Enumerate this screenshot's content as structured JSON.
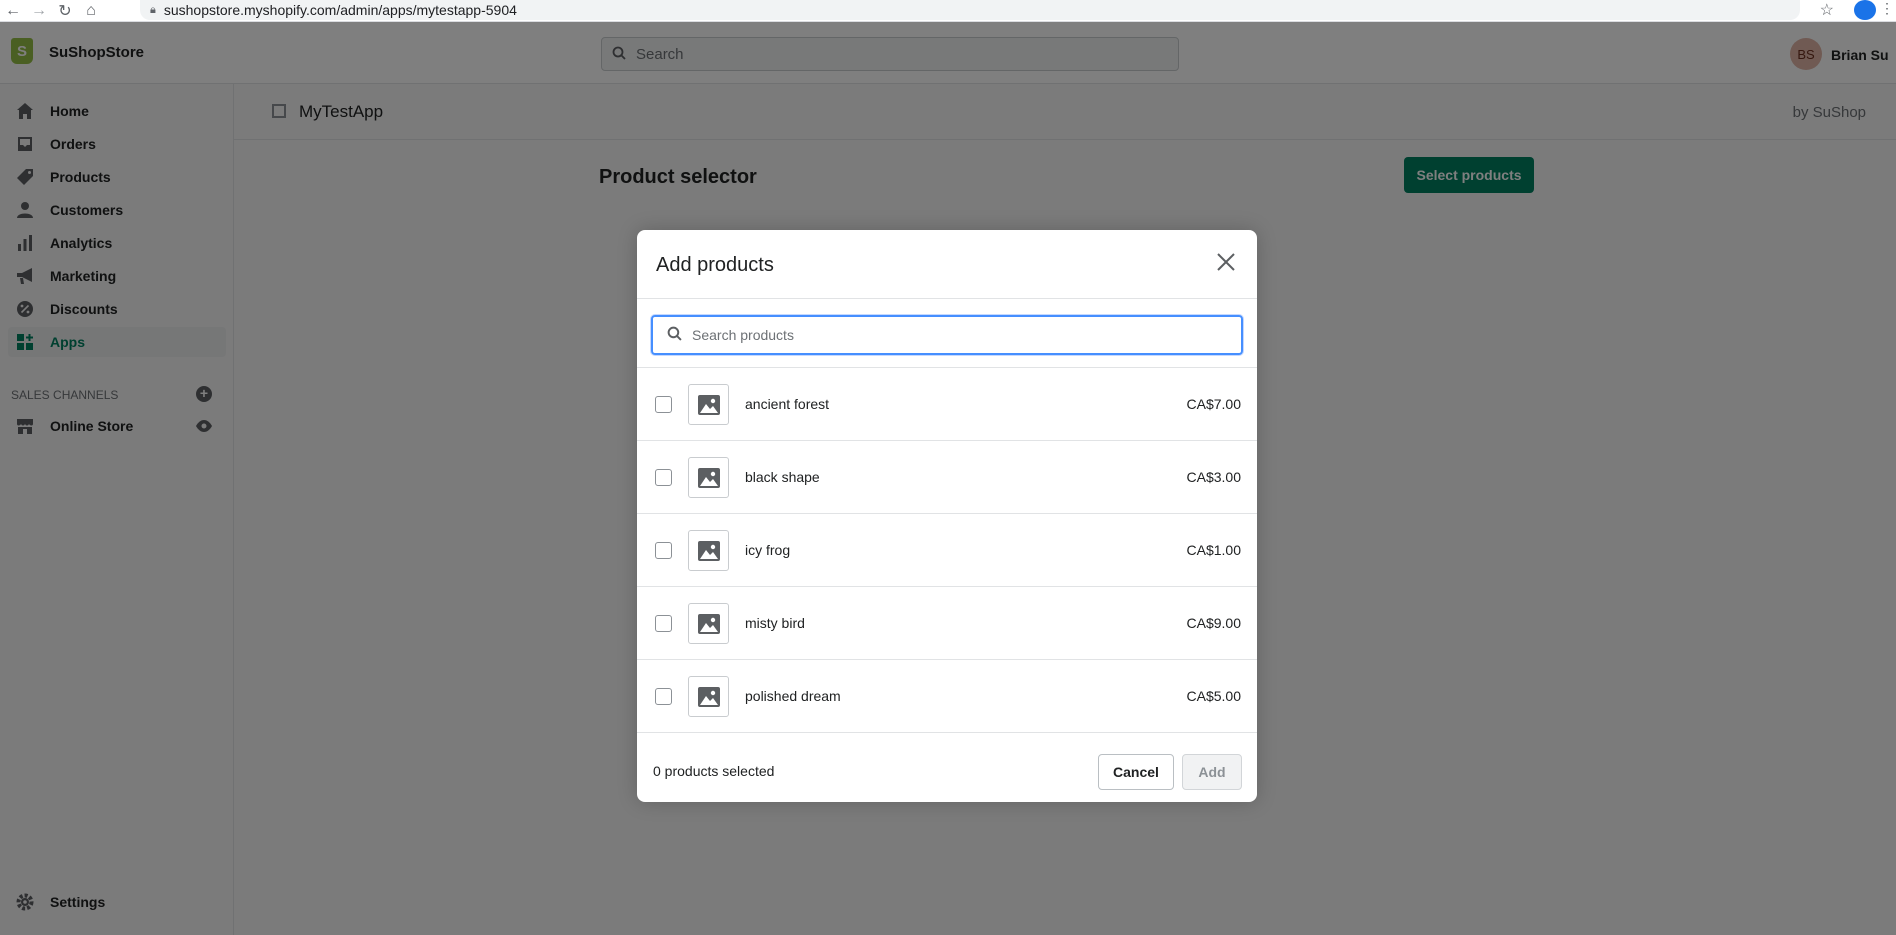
{
  "browser": {
    "url": "sushopstore.myshopify.com/admin/apps/mytestapp-5904",
    "back": "←",
    "forward": "→",
    "reload": "↻",
    "home": "⌂",
    "star": "☆",
    "more": "⋮"
  },
  "topbar": {
    "store_name": "SuShopStore",
    "search_placeholder": "Search",
    "avatar_initials": "BS",
    "user_name": "Brian Su"
  },
  "sidebar": {
    "items": [
      {
        "label": "Home",
        "icon": "home-icon"
      },
      {
        "label": "Orders",
        "icon": "orders-icon"
      },
      {
        "label": "Products",
        "icon": "tag-icon"
      },
      {
        "label": "Customers",
        "icon": "person-icon"
      },
      {
        "label": "Analytics",
        "icon": "bar-chart-icon"
      },
      {
        "label": "Marketing",
        "icon": "megaphone-icon"
      },
      {
        "label": "Discounts",
        "icon": "discount-icon"
      },
      {
        "label": "Apps",
        "icon": "apps-icon"
      }
    ],
    "sales_channels_title": "SALES CHANNELS",
    "online_store": "Online Store",
    "settings": "Settings"
  },
  "app": {
    "title": "MyTestApp",
    "by": "by SuShop",
    "page_title": "Product selector",
    "select_button": "Select products"
  },
  "modal": {
    "title": "Add products",
    "search_placeholder": "Search products",
    "products": [
      {
        "name": "ancient forest",
        "price": "CA$7.00"
      },
      {
        "name": "black shape",
        "price": "CA$3.00"
      },
      {
        "name": "icy frog",
        "price": "CA$1.00"
      },
      {
        "name": "misty bird",
        "price": "CA$9.00"
      },
      {
        "name": "polished dream",
        "price": "CA$5.00"
      }
    ],
    "selected_count": "0 products selected",
    "cancel": "Cancel",
    "add": "Add"
  },
  "colors": {
    "accent": "#008060",
    "focus": "#458fff"
  }
}
